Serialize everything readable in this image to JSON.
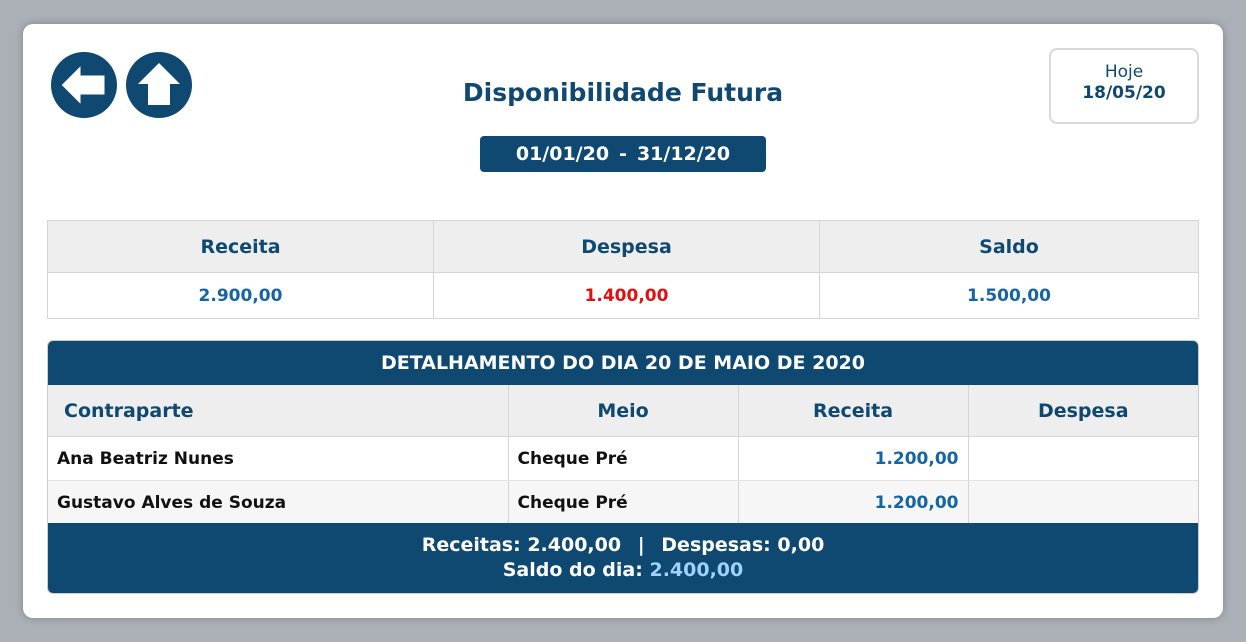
{
  "header": {
    "title": "Disponibilidade Futura",
    "today_label": "Hoje",
    "today_date": "18/05/20",
    "period_start": "01/01/20",
    "period_sep": "-",
    "period_end": "31/12/20"
  },
  "icons": {
    "back": "arrow-left-icon",
    "home": "arrow-up-icon",
    "accent": "#0f4870"
  },
  "summary": {
    "headers": [
      "Receita",
      "Despesa",
      "Saldo"
    ],
    "values": [
      "2.900,00",
      "1.400,00",
      "1.500,00"
    ],
    "colors": {
      "receita": "#1565a6",
      "despesa": "#e01010",
      "saldo": "#1565a6"
    }
  },
  "detail": {
    "title": "DETALHAMENTO DO DIA 20 DE MAIO DE 2020",
    "columns": [
      "Contraparte",
      "Meio",
      "Receita",
      "Despesa"
    ],
    "rows": [
      {
        "contraparte": "Ana Beatriz Nunes",
        "meio": "Cheque Pré",
        "receita": "1.200,00",
        "despesa": ""
      },
      {
        "contraparte": "Gustavo Alves de Souza",
        "meio": "Cheque Pré",
        "receita": "1.200,00",
        "despesa": ""
      }
    ],
    "footer": {
      "receitas_label": "Receitas:",
      "receitas_value": "2.400,00",
      "pipe": "|",
      "despesas_label": "Despesas:",
      "despesas_value": "0,00",
      "saldo_label": "Saldo do dia:",
      "saldo_value": "2.400,00"
    }
  }
}
